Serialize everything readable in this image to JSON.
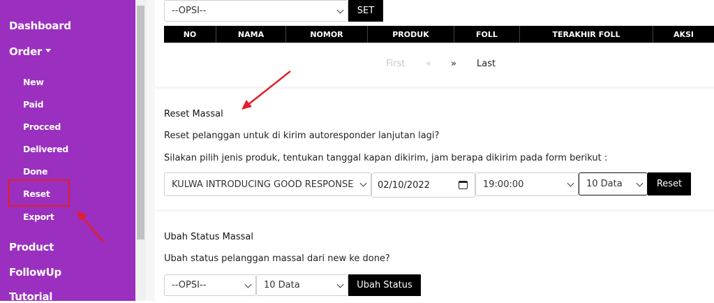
{
  "sidebar": {
    "items": {
      "dashboard": "Dashboard",
      "order": "Order",
      "new": "New",
      "paid": "Paid",
      "procced": "Procced",
      "delivered": "Delivered",
      "done": "Done",
      "reset": "Reset",
      "export": "Export",
      "product": "Product",
      "followup": "FollowUp",
      "tutorial": "Tutorial"
    }
  },
  "top": {
    "opsi_value": "--OPSI--",
    "set_label": "SET"
  },
  "table": {
    "columns": [
      "NO",
      "NAMA",
      "NOMOR",
      "PRODUK",
      "FOLL",
      "TERAKHIR FOLL",
      "AKSI"
    ]
  },
  "pager": {
    "first": "First",
    "prev": "«",
    "next": "»",
    "last": "Last"
  },
  "reset_section": {
    "title": "Reset Massal",
    "question": "Reset pelanggan untuk di kirim autoresponder lanjutan lagi?",
    "instruction": "Silakan pilih jenis produk, tentukan tanggal kapan dikirim, jam berapa dikirim pada form berikut :",
    "product_value": "KULWA INTRODUCING GOOD RESPONSE",
    "date_value": "02/10/2022",
    "time_value": "19:00:00",
    "count_value": "10 Data",
    "button_label": "Reset"
  },
  "status_section": {
    "title": "Ubah Status Massal",
    "question": "Ubah status pelanggan massal dari new ke done?",
    "opsi_value": "--OPSI--",
    "count_value": "10 Data",
    "button_label": "Ubah Status"
  },
  "colors": {
    "sidebar": "#9b2fbf",
    "annotation": "#e0202a"
  }
}
